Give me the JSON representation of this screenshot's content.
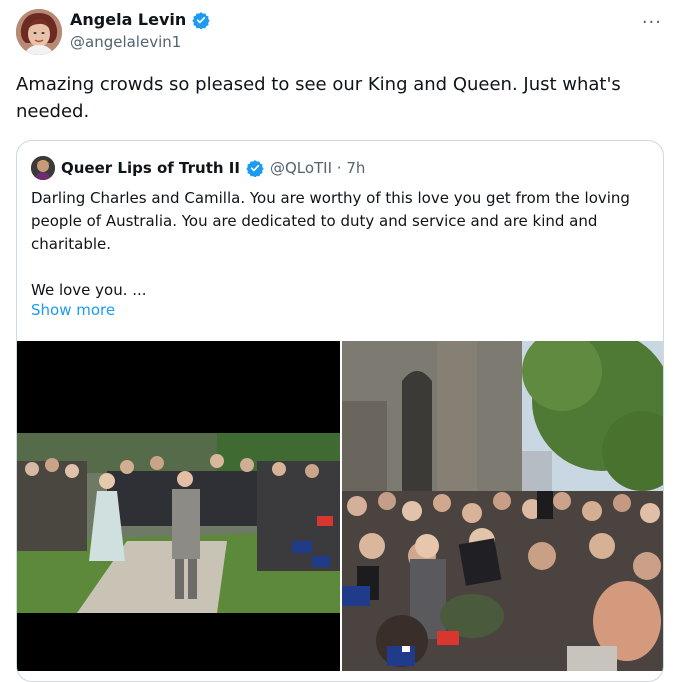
{
  "author": {
    "name": "Angela Levin",
    "handle": "@angelalevin1",
    "avatar_icon": "author-avatar",
    "verified_color": "#1d9bf0"
  },
  "more_icon": "more-horizontal-icon",
  "more_glyph": "···",
  "tweet_text": "Amazing crowds so pleased to see our King and Queen.  Just what's needed.",
  "quoted": {
    "name": "Queer Lips of Truth II",
    "handle_time": "@QLoTII · 7h",
    "text_lines": [
      "Darling Charles and Camilla. You are worthy of this love you get from the loving people of Australia. You are dedicated to duty and service and are kind and charitable.",
      "We love you.  ..."
    ],
    "show_more": "Show more",
    "media": [
      {
        "kind": "photo",
        "description_icon": "video-thumbnail-left"
      },
      {
        "kind": "photo",
        "description_icon": "video-thumbnail-right"
      }
    ]
  },
  "colors": {
    "link": "#1d9bf0",
    "secondary_text": "#536471",
    "border": "#cfd9de"
  }
}
